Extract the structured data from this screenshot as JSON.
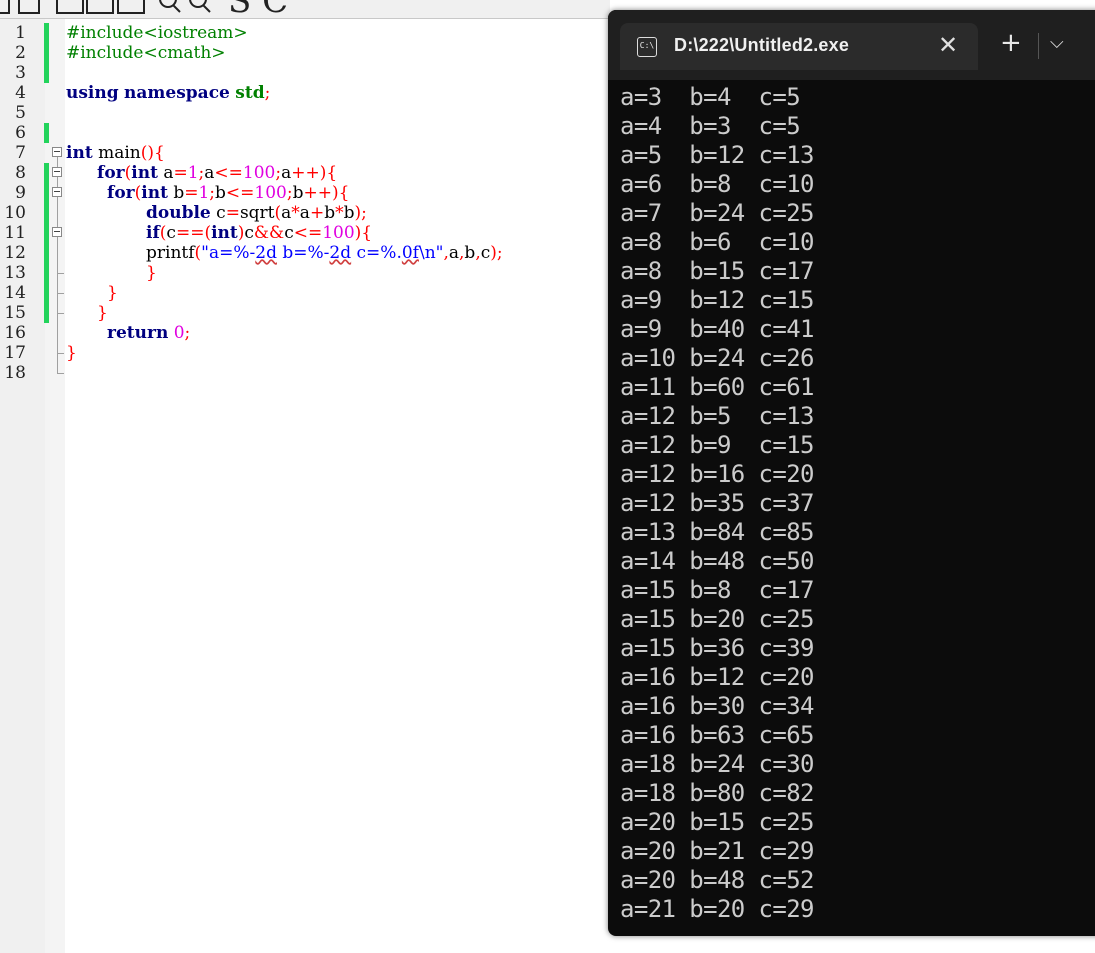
{
  "toolbar": {
    "zoom_glyph": "S C"
  },
  "editor": {
    "line_numbers": [
      "1",
      "2",
      "3",
      "4",
      "5",
      "6",
      "7",
      "8",
      "9",
      "10",
      "11",
      "12",
      "13",
      "14",
      "15",
      "16",
      "17",
      "18"
    ],
    "lines": {
      "l1": "#include<iostream>",
      "l2": "#include<cmath>",
      "l4_kw1": "using",
      "l4_kw2": "namespace",
      "l4_std": "std",
      "l4_semi": ";",
      "l7_kw": "int",
      "l7_rest": " main",
      "l7_sym": "(){",
      "l8_for": "for",
      "l8_p1": "(",
      "l8_int": "int",
      "l8_a": " a",
      "l8_eq": "=",
      "l8_1": "1",
      "l8_s1": ";",
      "l8_a2": "a",
      "l8_lt": "<=",
      "l8_100": "100",
      "l8_s2": ";",
      "l8_a3": "a",
      "l8_pp": "++){",
      "l9_for": "for",
      "l9_p1": "(",
      "l9_int": "int",
      "l9_b": " b",
      "l9_eq": "=",
      "l9_1": "1",
      "l9_s1": ";",
      "l9_b2": "b",
      "l9_lt": "<=",
      "l9_100": "100",
      "l9_s2": ";",
      "l9_b3": "b",
      "l9_pp": "++){",
      "l10_double": "double",
      "l10_c": " c",
      "l10_eq": "=",
      "l10_sqrt": "sqrt",
      "l10_p": "(",
      "l10_a": "a",
      "l10_m1": "*",
      "l10_a2": "a",
      "l10_plus": "+",
      "l10_b": "b",
      "l10_m2": "*",
      "l10_b2": "b",
      "l10_end": ");",
      "l11_if": "if",
      "l11_p": "(",
      "l11_c": "c",
      "l11_eqeq": "==(",
      "l11_int": "int",
      "l11_cp": ")",
      "l11_c2": "c",
      "l11_and": "&&",
      "l11_c3": "c",
      "l11_lt": "<=",
      "l11_100": "100",
      "l11_end": "){",
      "l12_printf": "printf",
      "l12_p": "(",
      "l12_str1": "\"a=%-",
      "l12_fmt1": "2d",
      "l12_str2": " b=%-",
      "l12_fmt2": "2d",
      "l12_str3": " c=%.",
      "l12_fmt3": "0f",
      "l12_str4": "\\n\"",
      "l12_args_c1": ",",
      "l12_args_a": "a",
      "l12_args_c2": ",",
      "l12_args_b": "b",
      "l12_args_c3": ",",
      "l12_args_c": "c",
      "l12_end": ");",
      "l13": "}",
      "l14": "}",
      "l15": "}",
      "l16_ret": "return",
      "l16_0": " 0",
      "l16_semi": ";",
      "l17": "}"
    }
  },
  "terminal": {
    "tab_title": "D:\\222\\Untitled2.exe",
    "tab_icon_text": "C:\\",
    "close_glyph": "✕",
    "new_tab_glyph": "+",
    "dropdown_glyph": "⌵",
    "output": [
      "a=3  b=4  c=5",
      "a=4  b=3  c=5",
      "a=5  b=12 c=13",
      "a=6  b=8  c=10",
      "a=7  b=24 c=25",
      "a=8  b=6  c=10",
      "a=8  b=15 c=17",
      "a=9  b=12 c=15",
      "a=9  b=40 c=41",
      "a=10 b=24 c=26",
      "a=11 b=60 c=61",
      "a=12 b=5  c=13",
      "a=12 b=9  c=15",
      "a=12 b=16 c=20",
      "a=12 b=35 c=37",
      "a=13 b=84 c=85",
      "a=14 b=48 c=50",
      "a=15 b=8  c=17",
      "a=15 b=20 c=25",
      "a=15 b=36 c=39",
      "a=16 b=12 c=20",
      "a=16 b=30 c=34",
      "a=16 b=63 c=65",
      "a=18 b=24 c=30",
      "a=18 b=80 c=82",
      "a=20 b=15 c=25",
      "a=20 b=21 c=29",
      "a=20 b=48 c=52",
      "a=21 b=20 c=29"
    ]
  },
  "colors": {
    "keyword": "#000080",
    "preprocessor": "#008000",
    "number": "#e000e0",
    "string": "#0000ff",
    "symbol": "#ff0000",
    "change_marker": "#22d35b",
    "terminal_bg": "#0c0c0c",
    "terminal_text": "#cccccc"
  }
}
